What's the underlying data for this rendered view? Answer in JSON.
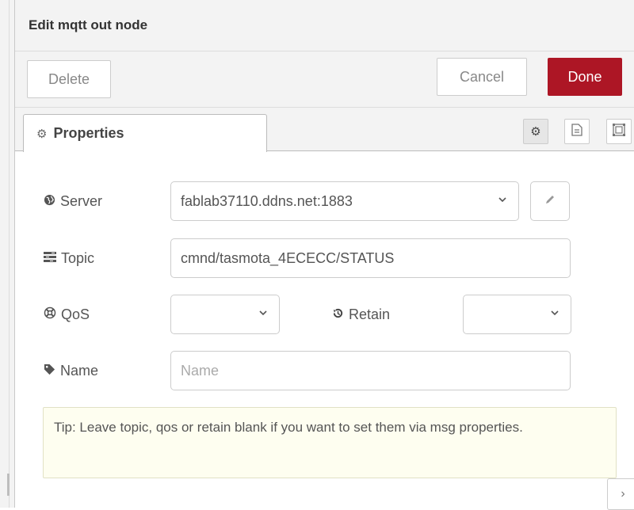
{
  "header": {
    "title": "Edit mqtt out node"
  },
  "toolbar": {
    "delete_label": "Delete",
    "cancel_label": "Cancel",
    "done_label": "Done"
  },
  "tabs": {
    "properties_label": "Properties",
    "icons": [
      "gear-icon",
      "file-text-icon",
      "object-group-icon"
    ]
  },
  "form": {
    "server": {
      "label": "Server",
      "value": "fablab37110.ddns.net:1883"
    },
    "topic": {
      "label": "Topic",
      "value": "cmnd/tasmota_4ECECC/STATUS"
    },
    "qos": {
      "label": "QoS",
      "value": ""
    },
    "retain": {
      "label": "Retain",
      "value": ""
    },
    "name": {
      "label": "Name",
      "value": "",
      "placeholder": "Name"
    }
  },
  "tip": {
    "text": "Tip: Leave topic, qos or retain blank if you want to set them via msg properties."
  },
  "colors": {
    "done_button": "#ad1625",
    "tip_background": "#fefef0",
    "tray_background": "#f3f3f3"
  }
}
